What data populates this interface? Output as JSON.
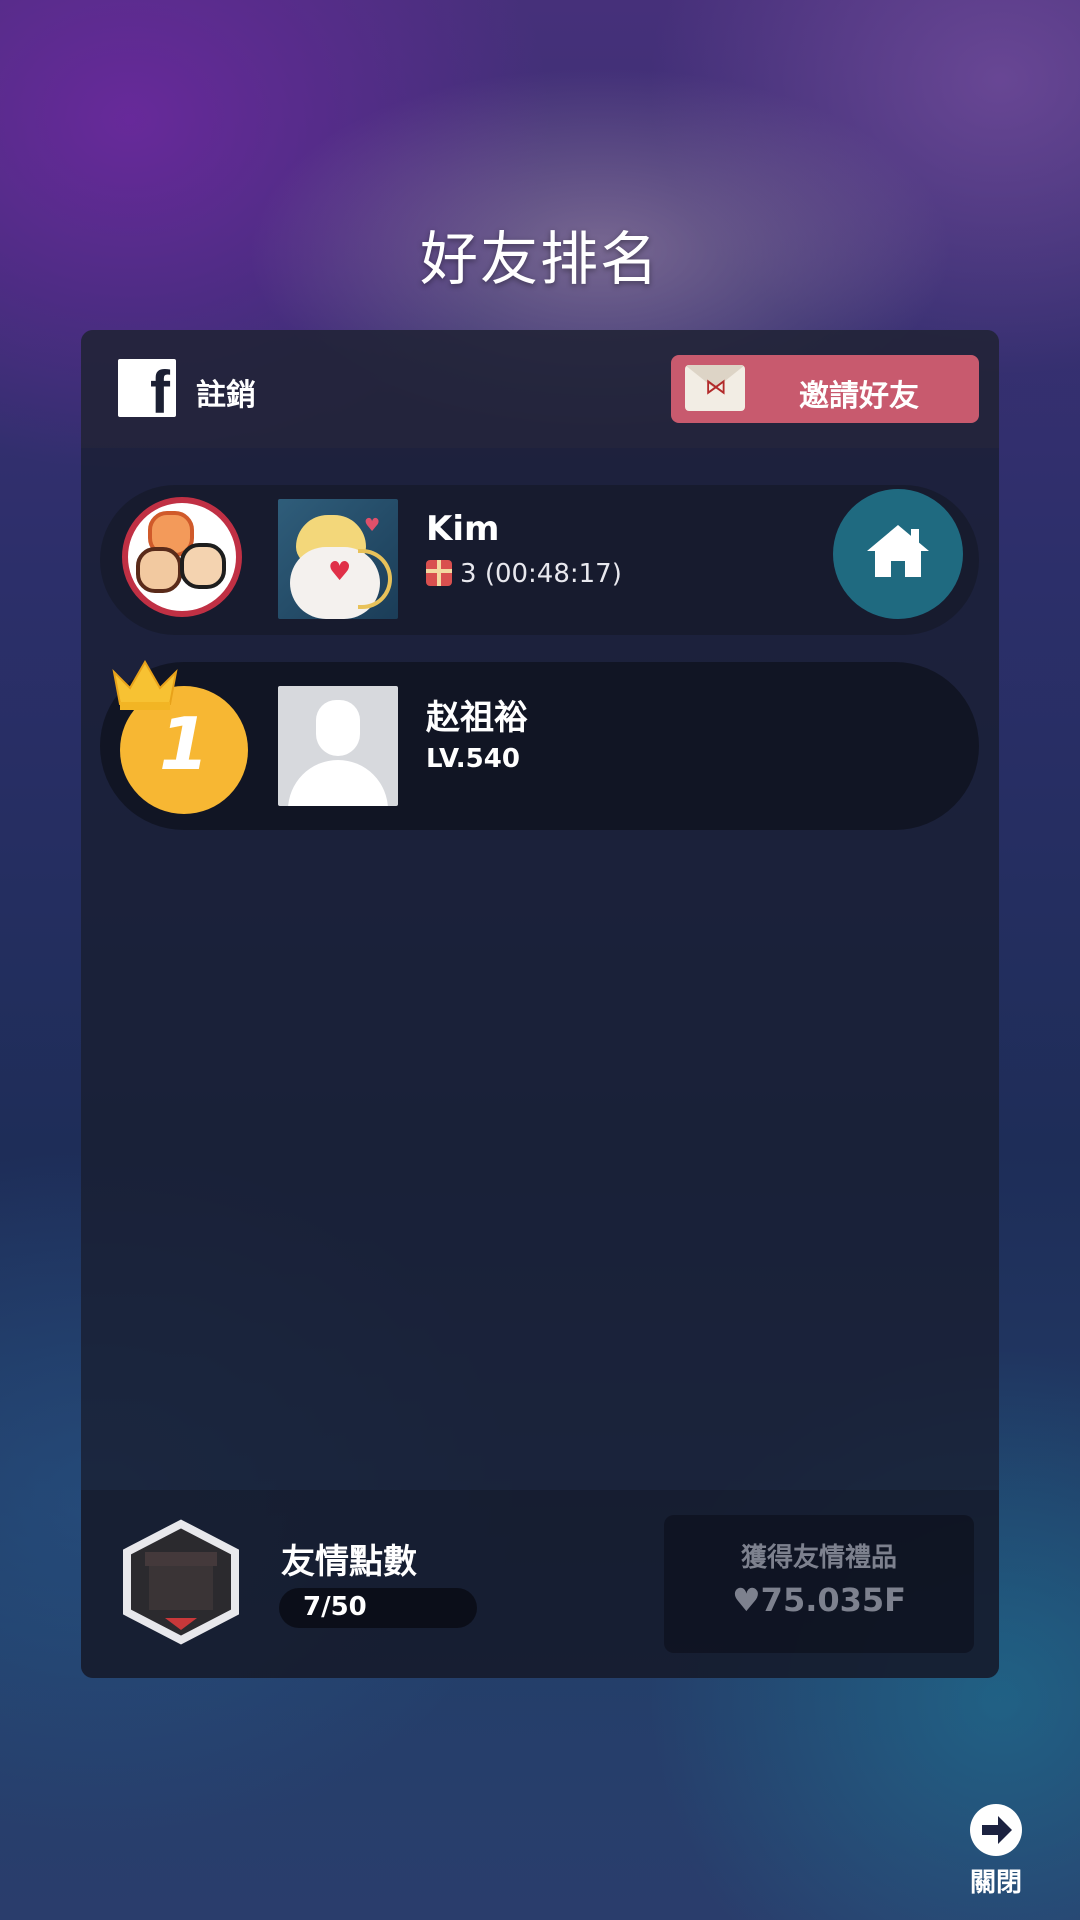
{
  "header": {
    "title": "好友排名"
  },
  "account": {
    "logout_label": "註銷",
    "invite_label": "邀請好友"
  },
  "rows": [
    {
      "name": "Kim",
      "gift_count": "3",
      "timer": "(00:48:17)"
    },
    {
      "rank": "1",
      "name": "赵祖裕",
      "level": "LV.540"
    }
  ],
  "footer": {
    "friendship_label": "友情點數",
    "friendship_count": "7/50",
    "reward_title": "獲得友情禮品",
    "reward_value": "75.035F"
  },
  "close": {
    "label": "關閉"
  },
  "colors": {
    "invite": "#c85a6e",
    "home": "#1f6a80",
    "rank": "#f7b733"
  },
  "icons": [
    "facebook-icon",
    "envelope-icon",
    "gift-icon",
    "home-icon",
    "crown-icon",
    "heart-icon",
    "arrow-right-icon"
  ]
}
